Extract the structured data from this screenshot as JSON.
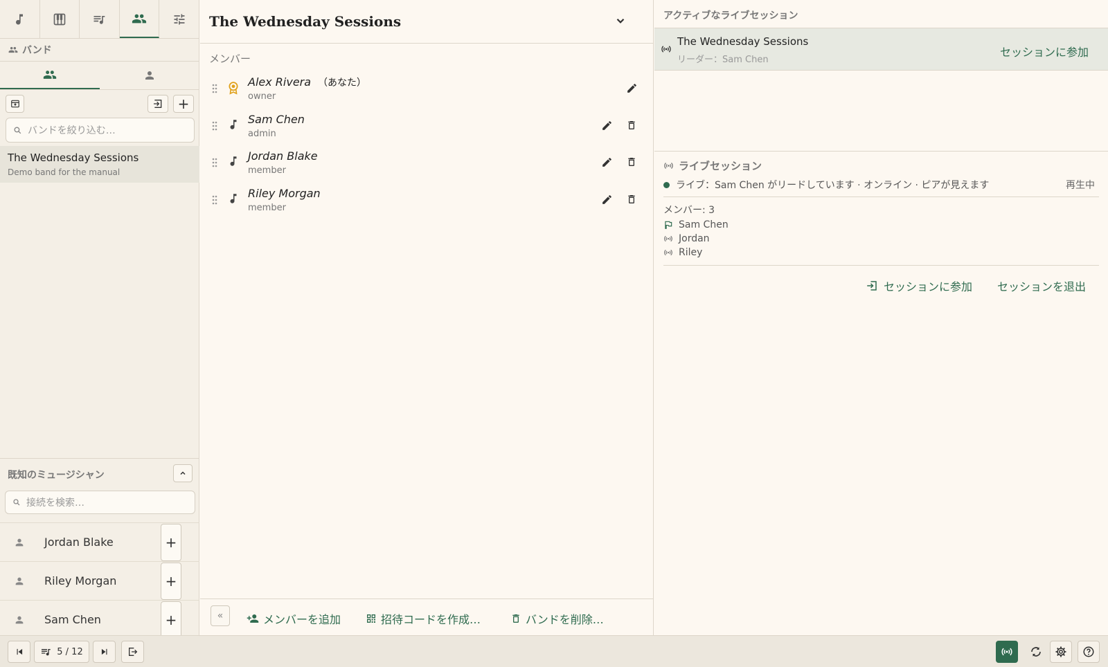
{
  "app": {
    "accent": "#2f6b4f",
    "background": "#fdf8f1"
  },
  "topnav": [
    {
      "name": "music-note-icon",
      "active": false
    },
    {
      "name": "piano-icon",
      "active": false
    },
    {
      "name": "queue-music-icon",
      "active": false
    },
    {
      "name": "people-icon",
      "active": true
    },
    {
      "name": "tune-icon",
      "active": false
    }
  ],
  "sidebar": {
    "section_title": "バンド",
    "search_placeholder": "バンドを絞り込む…",
    "bands": [
      {
        "title": "The Wednesday Sessions",
        "subtitle": "Demo band for the manual"
      }
    ],
    "known": {
      "title": "既知のミュージシャン",
      "search_placeholder": "接続を検索…",
      "musicians": [
        {
          "name": "Jordan Blake"
        },
        {
          "name": "Riley Morgan"
        },
        {
          "name": "Sam Chen"
        }
      ]
    }
  },
  "main": {
    "band_title": "The Wednesday Sessions",
    "members_label": "メンバー",
    "members": [
      {
        "name": "Alex Rivera",
        "you": "（あなた）",
        "role": "owner",
        "icon": "award-icon"
      },
      {
        "name": "Sam Chen",
        "you": "",
        "role": "admin",
        "icon": "music-note-icon"
      },
      {
        "name": "Jordan Blake",
        "you": "",
        "role": "member",
        "icon": "music-note-icon"
      },
      {
        "name": "Riley Morgan",
        "you": "",
        "role": "member",
        "icon": "music-note-icon"
      }
    ],
    "footer": {
      "collapse": "«",
      "add_member": "メンバーを追加",
      "invite_code": "招待コードを作成…",
      "delete_band": "バンドを削除…"
    }
  },
  "right": {
    "active_title": "アクティブなライブセッション",
    "session": {
      "name": "The Wednesday Sessions",
      "leader": "リーダー：Sam Chen",
      "join": "セッションに参加"
    },
    "live": {
      "title": "ライブセッション",
      "status": "ライブ：Sam Chen がリードしています · オンライン · ピアが見えます",
      "state": "再生中",
      "members_count": "メンバー: 3",
      "members": [
        {
          "name": "Sam Chen",
          "icon": "flag-icon"
        },
        {
          "name": "Jordan",
          "icon": "broadcast-icon"
        },
        {
          "name": "Riley",
          "icon": "broadcast-icon"
        }
      ],
      "join": "セッションに参加",
      "leave": "セッションを退出"
    }
  },
  "bottom": {
    "position": "5 / 12"
  }
}
